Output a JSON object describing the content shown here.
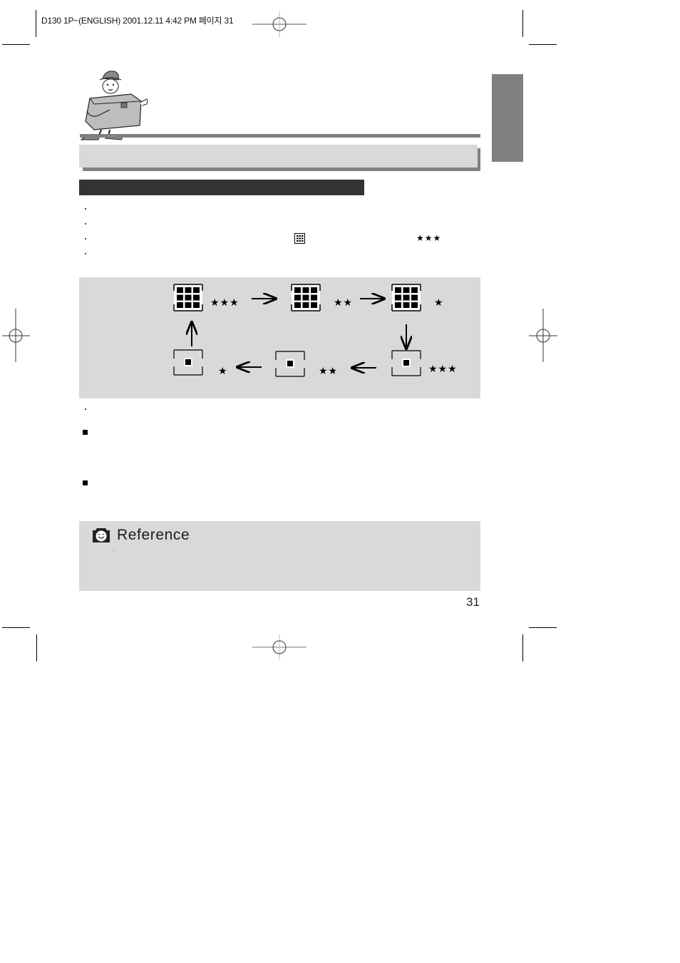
{
  "print_header": {
    "slug": "D130 1P~(ENGLISH)  2001.12.11  4:42 PM 페이지 31"
  },
  "mascot": {
    "icon": "camera-mascot-illustration"
  },
  "title_bar": {
    "text": ""
  },
  "subsection_bar": {
    "text": ""
  },
  "bullets": [
    {
      "text": ""
    },
    {
      "text": ""
    },
    {
      "text": "",
      "inline_icon": "multi-grid-icon",
      "inline_rating": "★★★"
    },
    {
      "text": ""
    }
  ],
  "diagram": {
    "description": "Mode cycle: metering/quality settings",
    "steps": [
      {
        "icon": "multi-grid-icon",
        "rating": "★★★"
      },
      {
        "icon": "multi-grid-icon",
        "rating": "★★"
      },
      {
        "icon": "multi-grid-icon",
        "rating": "★"
      },
      {
        "icon": "spot-icon",
        "rating": "★★★"
      },
      {
        "icon": "spot-icon",
        "rating": "★★"
      },
      {
        "icon": "spot-icon",
        "rating": "★"
      }
    ]
  },
  "after_diagram_bullet": {
    "text": ""
  },
  "square_items": [
    {
      "text": ""
    },
    {
      "text": ""
    }
  ],
  "reference": {
    "title": "Reference",
    "icon": "camera-smile-icon",
    "text": ""
  },
  "page_number": "31",
  "colors": {
    "tab_gray": "#808080",
    "panel_gray": "#d9d9d9",
    "dark_bar": "#333333"
  }
}
